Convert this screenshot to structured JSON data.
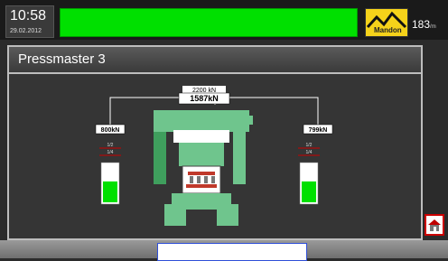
{
  "header": {
    "time": "10:58",
    "date": "29.02.2012",
    "logo_text": "Mandon",
    "counter_value": "183",
    "counter_unit": "/m"
  },
  "panel": {
    "title": "Pressmaster 3"
  },
  "press": {
    "max_force": "2200 kN",
    "total_force": "1587kN",
    "left_force": "800kN",
    "right_force": "799kN",
    "left_scale_top": "1/2",
    "left_scale_mid": "1/4",
    "right_scale_top": "1/2",
    "right_scale_mid": "1/4",
    "left_gauge_level": 0.55,
    "right_gauge_level": 0.55
  },
  "colors": {
    "accent_green": "#00e000",
    "machine_green": "#6fc58d",
    "logo_yellow": "#f5d21a",
    "alarm_red": "#cc0000"
  },
  "icons": {
    "home": "home-icon"
  }
}
